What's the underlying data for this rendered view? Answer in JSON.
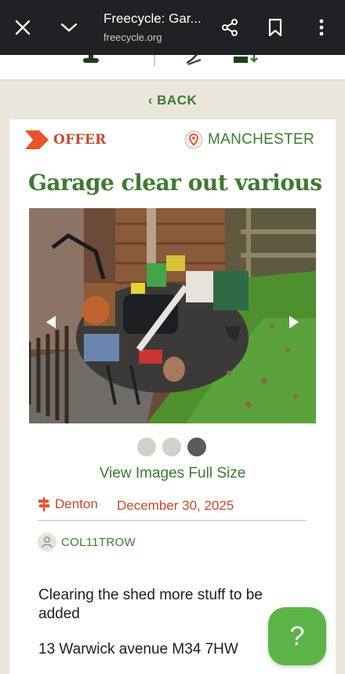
{
  "browser": {
    "title": "Freecycle: Gar...",
    "url": "freecycle.org",
    "icons": [
      "close-icon",
      "chevron-down-icon",
      "share-icon",
      "bookmark-icon",
      "more-vert-icon"
    ]
  },
  "nav": {
    "back_label": "‹ BACK"
  },
  "post": {
    "type": "OFFER",
    "location": "MANCHESTER",
    "title": "Garage clear out various",
    "images": {
      "count": 3,
      "active_index": 2
    },
    "view_images_label": "View Images Full Size",
    "area": "Denton",
    "date": "December 30, 2025",
    "user": "COL11TROW",
    "description": "Clearing the shed more stuff to be added",
    "address": "13 Warwick avenue M34 7HW"
  },
  "help": {
    "label": "?"
  },
  "colors": {
    "brand_green": "#3e7a2f",
    "offer_orange": "#c8482a",
    "help_green": "#5cb449"
  }
}
